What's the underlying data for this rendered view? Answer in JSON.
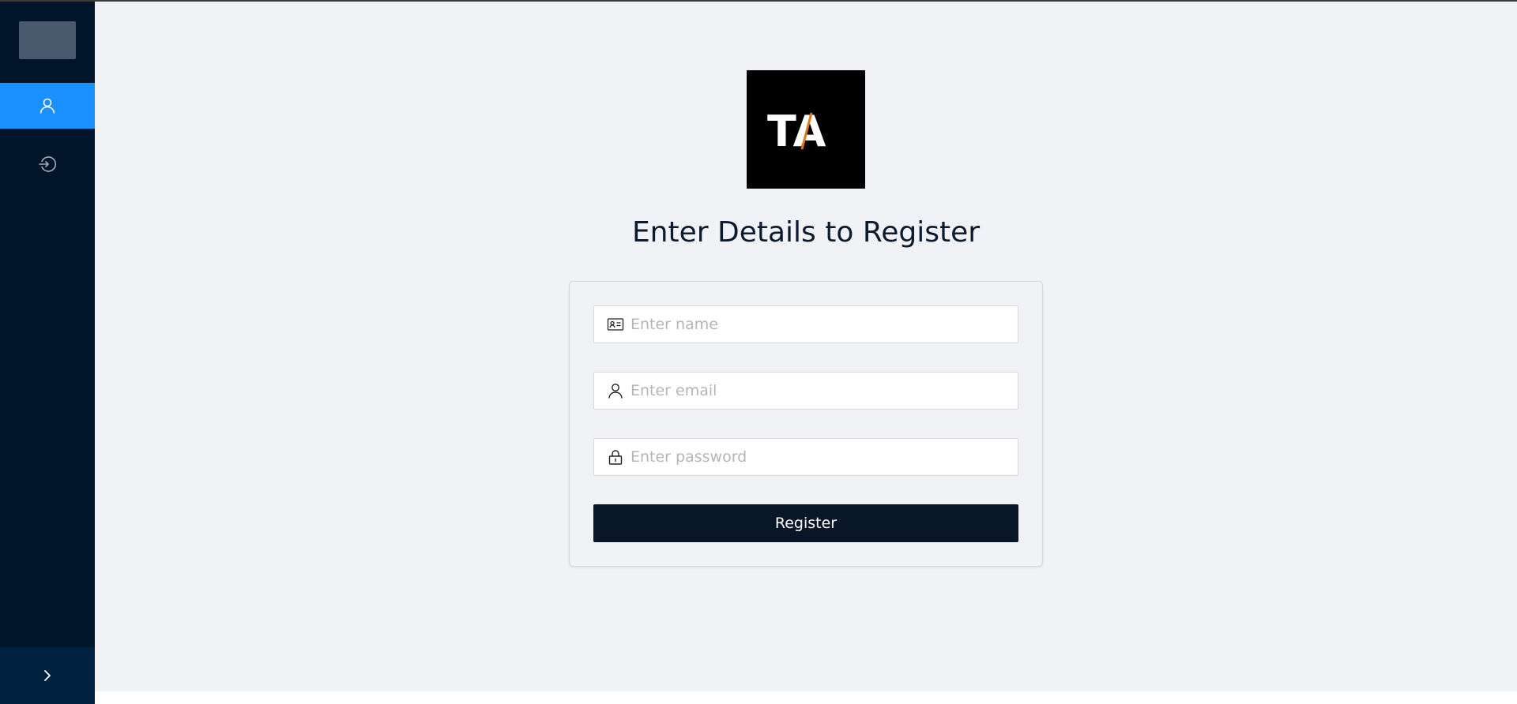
{
  "sidebar": {
    "menu": [
      {
        "icon": "user-icon",
        "active": true
      },
      {
        "icon": "login-icon",
        "active": false
      }
    ],
    "trigger_icon": "chevron-right-icon"
  },
  "logo": {
    "text": "TA"
  },
  "page": {
    "title": "Enter Details to Register"
  },
  "form": {
    "name_placeholder": "Enter name",
    "email_placeholder": "Enter email",
    "password_placeholder": "Enter password",
    "submit_label": "Register"
  },
  "colors": {
    "sidebar_bg": "#001529",
    "active_item": "#1890ff",
    "button_bg": "#091628",
    "page_bg": "#f0f2f5"
  }
}
